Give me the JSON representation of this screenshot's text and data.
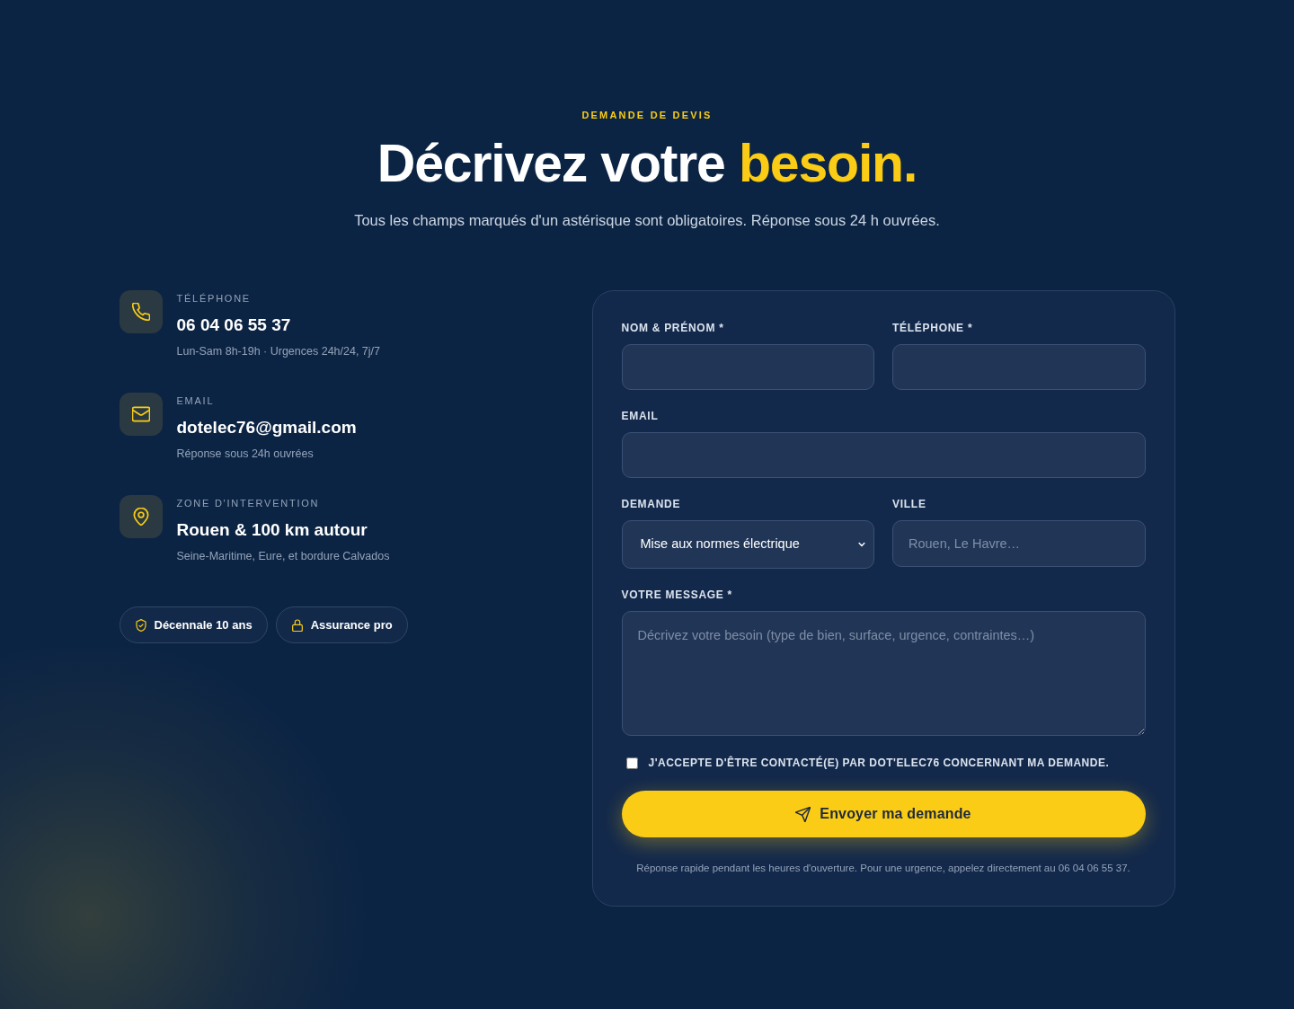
{
  "header": {
    "eyebrow": "DEMANDE DE DEVIS",
    "title": "Décrivez votre",
    "title_highlight": "besoin.",
    "subtitle": "Tous les champs marqués d'un astérisque sont obligatoires. Réponse sous 24 h ouvrées."
  },
  "contacts": [
    {
      "kind": "phone",
      "label": "TÉLÉPHONE",
      "value": "06 04 06 55 37",
      "note": "Lun-Sam 8h-19h · Urgences 24h/24, 7j/7"
    },
    {
      "kind": "email",
      "label": "EMAIL",
      "value": "dotelec76@gmail.com",
      "note": "Réponse sous 24h ouvrées"
    },
    {
      "kind": "location",
      "label": "ZONE D'INTERVENTION",
      "value": "Rouen & 100 km autour",
      "note": "Seine-Maritime, Eure, et bordure Calvados"
    }
  ],
  "badges": [
    {
      "kind": "shield",
      "text": "Décennale 10 ans"
    },
    {
      "kind": "lock",
      "text": "Assurance pro"
    }
  ],
  "form": {
    "rows": [
      [
        {
          "kind": "input",
          "label": "NOM & PRÉNOM *"
        },
        {
          "kind": "input",
          "label": "TÉLÉPHONE *"
        }
      ],
      [
        {
          "kind": "input",
          "label": "EMAIL"
        }
      ],
      [
        {
          "kind": "select",
          "label": "DEMANDE",
          "value": "Mise aux normes électrique"
        },
        {
          "kind": "input",
          "label": "VILLE",
          "placeholder": "Rouen, Le Havre…"
        }
      ],
      [
        {
          "kind": "textarea",
          "label": "VOTRE MESSAGE *",
          "placeholder": "Décrivez votre besoin (type de bien, surface, urgence, contraintes…)"
        }
      ]
    ],
    "consent": {
      "label": "J'ACCEPTE D'ÊTRE CONTACTÉ(E) PAR DOT'ELEC76 CONCERNANT MA DEMANDE.",
      "checked": false
    },
    "submit": {
      "label": "Envoyer ma demande"
    },
    "footnote": "Réponse rapide pendant les heures d'ouverture. Pour une urgence, appelez directement au 06 04 06 55 37."
  }
}
